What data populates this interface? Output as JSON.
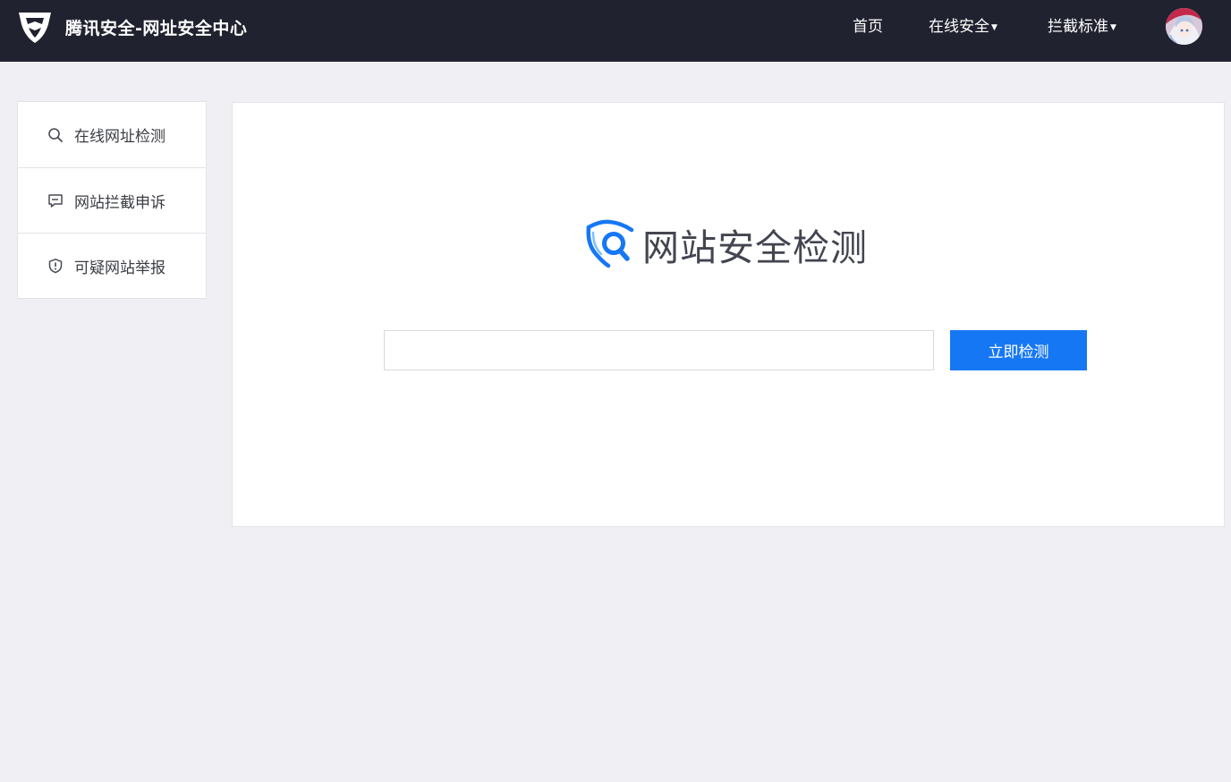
{
  "header": {
    "title": "腾讯安全-网址安全中心",
    "logo_icon": "tencent-security-shield-icon",
    "nav": {
      "home": "首页",
      "online_security": "在线安全",
      "intercept_standards": "拦截标准"
    },
    "dropdown_icon": "caret-down-icon",
    "avatar_icon": "user-avatar"
  },
  "sidebar": {
    "items": [
      {
        "label": "在线网址检测",
        "icon": "search-icon"
      },
      {
        "label": "网站拦截申诉",
        "icon": "chat-bubble-icon"
      },
      {
        "label": "可疑网站举报",
        "icon": "shield-alert-icon"
      }
    ]
  },
  "main": {
    "title": "网站安全检测",
    "title_icon": "shield-search-icon",
    "input_value": "",
    "button_label": "立即检测"
  },
  "colors": {
    "header_bg": "#20222f",
    "page_bg": "#efeff4",
    "accent": "#1677f5",
    "text_dark": "#434550"
  }
}
